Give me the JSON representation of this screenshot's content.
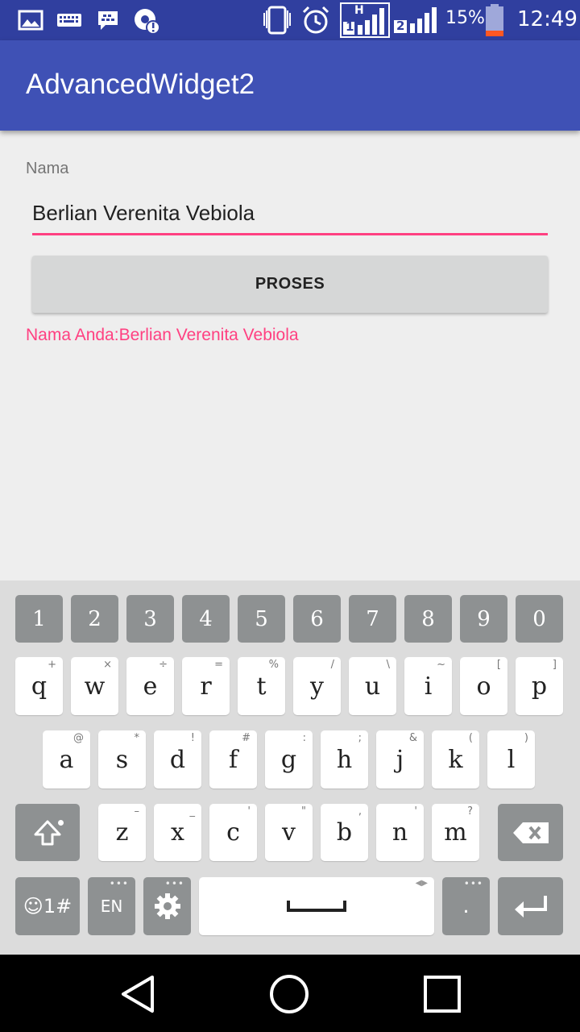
{
  "status_bar": {
    "battery_percent": "15%",
    "time": "12:49",
    "network_type": "H",
    "sim1_label": "1",
    "sim2_label": "2",
    "battery_level": 0.15
  },
  "app_bar": {
    "title": "AdvancedWidget2"
  },
  "form": {
    "name_label": "Nama",
    "name_value": "Berlian Verenita Vebiola",
    "button_label": "PROSES",
    "result": "Nama Anda:Berlian Verenita Vebiola"
  },
  "colors": {
    "status_bar": "#303f9f",
    "app_bar": "#3f51b5",
    "accent": "#ff4081"
  },
  "keyboard": {
    "numbers": [
      "1",
      "2",
      "3",
      "4",
      "5",
      "6",
      "7",
      "8",
      "9",
      "0"
    ],
    "row1": [
      {
        "key": "q",
        "sym": "+"
      },
      {
        "key": "w",
        "sym": "×"
      },
      {
        "key": "e",
        "sym": "÷"
      },
      {
        "key": "r",
        "sym": "="
      },
      {
        "key": "t",
        "sym": "%"
      },
      {
        "key": "y",
        "sym": "/"
      },
      {
        "key": "u",
        "sym": "\\"
      },
      {
        "key": "i",
        "sym": "~"
      },
      {
        "key": "o",
        "sym": "["
      },
      {
        "key": "p",
        "sym": "]"
      }
    ],
    "row2": [
      {
        "key": "a",
        "sym": "@"
      },
      {
        "key": "s",
        "sym": "*"
      },
      {
        "key": "d",
        "sym": "!"
      },
      {
        "key": "f",
        "sym": "#"
      },
      {
        "key": "g",
        "sym": ":"
      },
      {
        "key": "h",
        "sym": ";"
      },
      {
        "key": "j",
        "sym": "&"
      },
      {
        "key": "k",
        "sym": "("
      },
      {
        "key": "l",
        "sym": ")"
      }
    ],
    "row3": [
      {
        "key": "z",
        "sym": "–"
      },
      {
        "key": "x",
        "sym": "_"
      },
      {
        "key": "c",
        "sym": "'"
      },
      {
        "key": "v",
        "sym": "\""
      },
      {
        "key": "b",
        "sym": ","
      },
      {
        "key": "n",
        "sym": "'"
      },
      {
        "key": "m",
        "sym": "?"
      }
    ],
    "symbols_key": "☺1#",
    "language_key": "EN",
    "period_key": ".",
    "icons": {
      "shift": "shift-icon",
      "backspace": "backspace-icon",
      "settings": "gear-icon",
      "space": "space-bar-icon",
      "enter": "enter-icon"
    }
  }
}
